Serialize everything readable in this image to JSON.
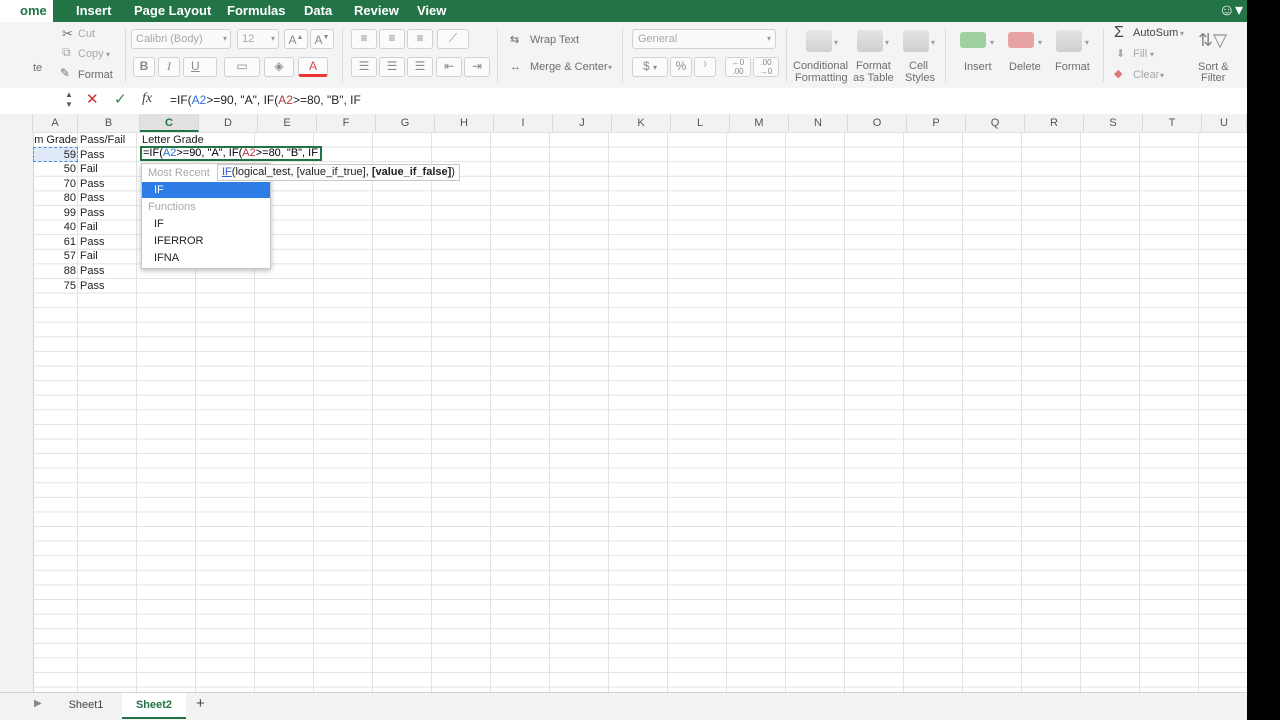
{
  "tabs": [
    "ome",
    "Insert",
    "Page Layout",
    "Formulas",
    "Data",
    "Review",
    "View"
  ],
  "ribbon": {
    "cut": "Cut",
    "copy": "Copy",
    "format": "Format",
    "paste_partial": "te",
    "font_name": "Calibri (Body)",
    "font_size": "12",
    "bold": "B",
    "italic": "I",
    "underline": "U",
    "wrap_text": "Wrap Text",
    "merge_center": "Merge & Center",
    "number_format": "General",
    "currency": "$",
    "percent": "%",
    "comma": "⁾",
    "conditional_formatting": [
      "Conditional",
      "Formatting"
    ],
    "format_as_table": [
      "Format",
      "as Table"
    ],
    "cell_styles": [
      "Cell",
      "Styles"
    ],
    "insert": "Insert",
    "delete": "Delete",
    "format_cells": "Format",
    "autosum": "AutoSum",
    "fill": "Fill",
    "clear": "Clear",
    "sort_filter": [
      "Sort &",
      "Filter"
    ]
  },
  "formula_bar": {
    "fx": "fx",
    "cancel": "✕",
    "confirm": "✓",
    "formula_parts": [
      "=IF(",
      "A2",
      ">=90, \"A\", IF(",
      "A2",
      ">=80, \"B\", IF"
    ]
  },
  "columns": [
    "A",
    "B",
    "C",
    "D",
    "E",
    "F",
    "G",
    "H",
    "I",
    "J",
    "K",
    "L",
    "M",
    "N",
    "O",
    "P",
    "Q",
    "R",
    "S",
    "T",
    "U"
  ],
  "headers": {
    "a": "m Grade",
    "b": "Pass/Fail",
    "c": "Letter Grade"
  },
  "rows": [
    {
      "a": "59",
      "b": "Pass"
    },
    {
      "a": "50",
      "b": "Fail"
    },
    {
      "a": "70",
      "b": "Pass"
    },
    {
      "a": "80",
      "b": "Pass"
    },
    {
      "a": "99",
      "b": "Pass"
    },
    {
      "a": "40",
      "b": "Fail"
    },
    {
      "a": "61",
      "b": "Pass"
    },
    {
      "a": "57",
      "b": "Fail"
    },
    {
      "a": "88",
      "b": "Pass"
    },
    {
      "a": "75",
      "b": "Pass"
    }
  ],
  "autocomplete": {
    "most_recent_label": "Most Recent",
    "recent_item": "IF",
    "functions_label": "Functions",
    "items": [
      "IF",
      "IFERROR",
      "IFNA"
    ]
  },
  "tooltip": {
    "fn": "IF",
    "args": "(logical_test, [value_if_true], ",
    "current_arg": "[value_if_false]",
    "close": ")"
  },
  "sheets": [
    "Sheet1",
    "Sheet2"
  ],
  "add_sheet": "+",
  "colors": {
    "excel_green": "#227447",
    "selection_blue": "#2e7ce6"
  }
}
